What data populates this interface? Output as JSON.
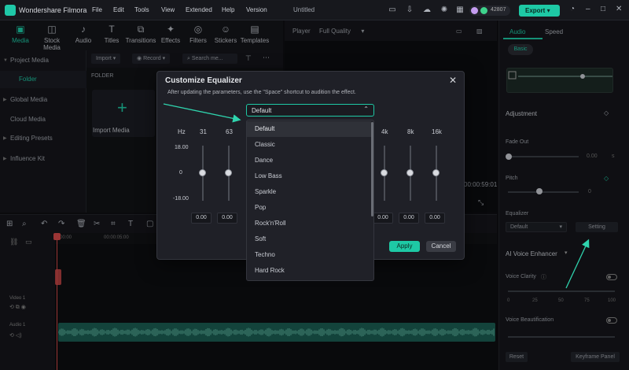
{
  "app": {
    "name": "Wondershare Filmora",
    "project": "Untitled",
    "menu": [
      "File",
      "Edit",
      "Tools",
      "View",
      "Extended",
      "Help",
      "Version"
    ],
    "credits": "42807",
    "export_label": "Export"
  },
  "media_tabs": [
    {
      "label": "Media",
      "icon": "media-icon"
    },
    {
      "label": "Stock Media",
      "icon": "stock-media-icon"
    },
    {
      "label": "Audio",
      "icon": "music-note-icon"
    },
    {
      "label": "Titles",
      "icon": "text-t-icon"
    },
    {
      "label": "Transitions",
      "icon": "transitions-icon"
    },
    {
      "label": "Effects",
      "icon": "effects-icon"
    },
    {
      "label": "Filters",
      "icon": "filters-icon"
    },
    {
      "label": "Stickers",
      "icon": "stickers-icon"
    },
    {
      "label": "Templates",
      "icon": "templates-icon"
    }
  ],
  "sidebar": {
    "items": [
      "Project Media",
      "Folder",
      "Global Media",
      "Cloud Media",
      "Editing Presets",
      "Influence Kit"
    ]
  },
  "media": {
    "import_label": "Import",
    "record_label": "Record",
    "search_placeholder": "Search me...",
    "folder_label": "FOLDER",
    "import_media_label": "Import Media"
  },
  "player": {
    "label": "Player",
    "quality": "Full Quality",
    "timecode": "00:00:59:01"
  },
  "right_panel": {
    "tabs": [
      "Audio",
      "Speed"
    ],
    "basic_label": "Basic",
    "adjustment": "Adjustment",
    "fade_out": "Fade Out",
    "fade_out_value": "0.00",
    "fade_out_unit": "s",
    "pitch": "Pitch",
    "pitch_value": "0",
    "equalizer": "Equalizer",
    "equalizer_value": "Default",
    "setting_label": "Setting",
    "ai_voice_enhancer": "AI Voice Enhancer",
    "voice_clarity": "Voice Clarity",
    "clarity_ticks": [
      "0",
      "25",
      "50",
      "75",
      "100"
    ],
    "voice_beautification": "Voice Beautification",
    "reset_label": "Reset",
    "keyframe_label": "Keyframe Panel"
  },
  "timeline": {
    "ruler": [
      "00:00",
      "00:00:05:00"
    ],
    "video_track": "Video 1",
    "audio_track": "Audio 1"
  },
  "dialog": {
    "title": "Customize Equalizer",
    "subtitle": "After updating the parameters, use the \"Space\" shortcut to audition the effect.",
    "preset": "Default",
    "hz_label": "Hz",
    "db_top": "18.00",
    "db_mid": "0",
    "db_bottom": "-18.00",
    "bands_left": [
      "31",
      "63"
    ],
    "bands_right": [
      "4k",
      "8k",
      "16k"
    ],
    "values_left": [
      "0.00",
      "0.00"
    ],
    "values_right": [
      "0.00",
      "0.00",
      "0.00"
    ],
    "presets": [
      "Default",
      "Classic",
      "Dance",
      "Low Bass",
      "Sparkle",
      "Pop",
      "Rock'n'Roll",
      "Soft",
      "Techno",
      "Hard Rock"
    ],
    "apply_label": "Apply",
    "cancel_label": "Cancel"
  },
  "colors": {
    "accent": "#1ec9a5",
    "panel": "#1f2027",
    "audio_clip": "#1b5e52",
    "playhead": "#d64a4a"
  }
}
